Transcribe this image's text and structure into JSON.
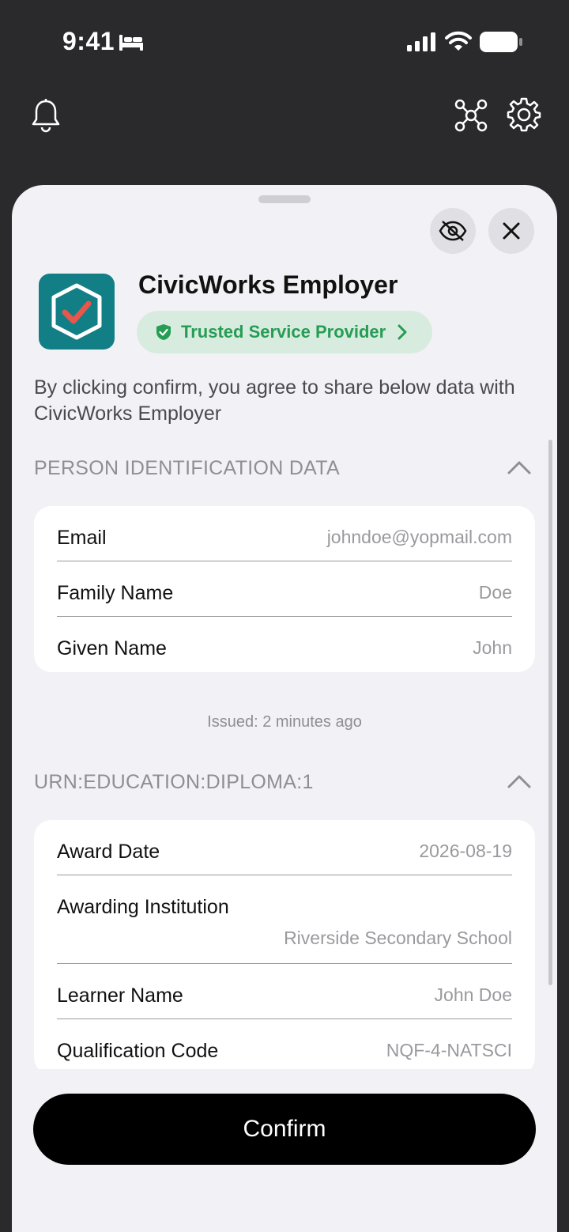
{
  "status_bar": {
    "time": "9:41"
  },
  "sheet": {
    "app": {
      "name": "CivicWorks Employer",
      "badge": "Trusted Service Provider"
    },
    "consent_text": "By clicking confirm, you agree to share below data with CivicWorks Employer",
    "sections": [
      {
        "title": "PERSON IDENTIFICATION DATA",
        "rows": [
          {
            "label": "Email",
            "value": "johndoe@yopmail.com"
          },
          {
            "label": "Family Name",
            "value": "Doe"
          },
          {
            "label": "Given Name",
            "value": "John"
          }
        ],
        "issued": "Issued: 2 minutes ago"
      },
      {
        "title": "URN:EDUCATION:DIPLOMA:1",
        "rows": [
          {
            "label": "Award Date",
            "value": "2026-08-19"
          },
          {
            "label": "Awarding Institution",
            "value": "Riverside Secondary School"
          },
          {
            "label": "Learner Name",
            "value": "John Doe"
          },
          {
            "label": "Qualification Code",
            "value": "NQF-4-NATSCI"
          }
        ]
      }
    ],
    "confirm_label": "Confirm"
  },
  "colors": {
    "accent": "#127f86",
    "trusted_green": "#279c55",
    "button": "#000000"
  }
}
